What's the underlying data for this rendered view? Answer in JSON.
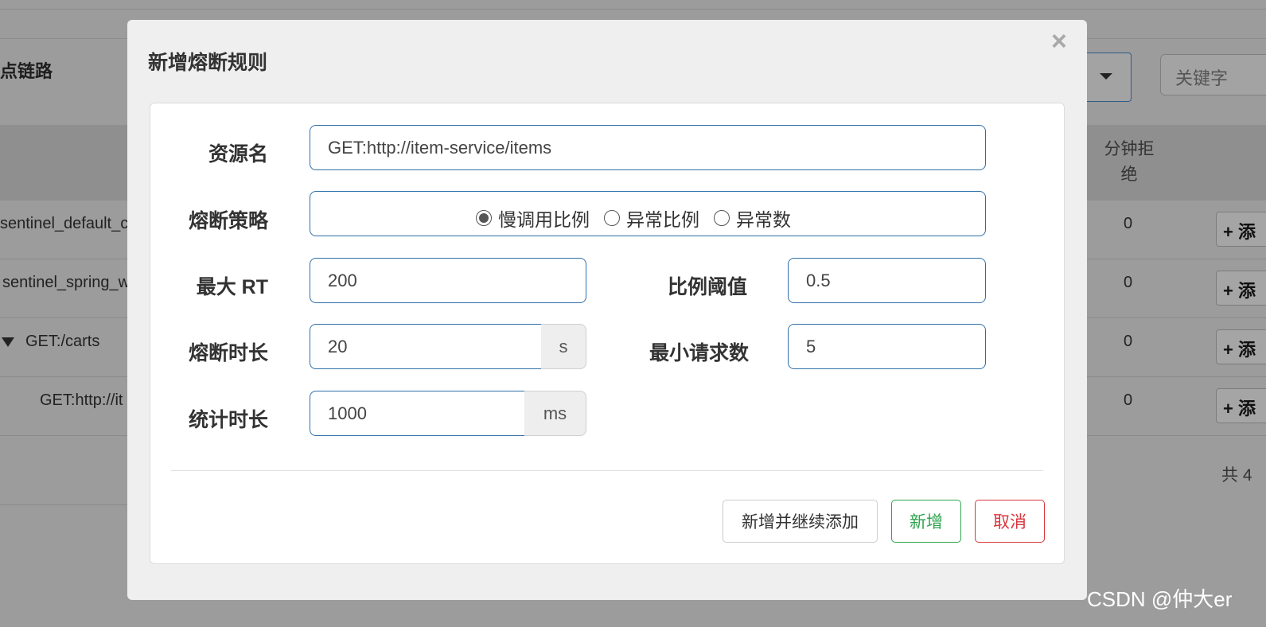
{
  "background": {
    "title": "点链路",
    "search_placeholder": "关键字",
    "column_header": "分钟拒绝",
    "rows": [
      {
        "name": "sentinel_default_c",
        "value": "0"
      },
      {
        "name": "sentinel_spring_w",
        "value": "0"
      },
      {
        "name": "GET:/carts",
        "value": "0"
      },
      {
        "name": "GET:http://it",
        "value": "0"
      }
    ],
    "add_button_label": "+ 添",
    "total": "共 4"
  },
  "modal": {
    "title": "新增熔断规则",
    "close": "×",
    "resource": {
      "label": "资源名",
      "value": "GET:http://item-service/items"
    },
    "strategy": {
      "label": "熔断策略",
      "options": [
        "慢调用比例",
        "异常比例",
        "异常数"
      ],
      "selected": "慢调用比例"
    },
    "max_rt": {
      "label": "最大 RT",
      "value": "200"
    },
    "ratio": {
      "label": "比例阈值",
      "value": "0.5"
    },
    "duration": {
      "label": "熔断时长",
      "value": "20",
      "unit": "s"
    },
    "min_requests": {
      "label": "最小请求数",
      "value": "5"
    },
    "stat_duration": {
      "label": "统计时长",
      "value": "1000",
      "unit": "ms"
    },
    "buttons": {
      "add_continue": "新增并继续添加",
      "add": "新增",
      "cancel": "取消"
    },
    "colors": {
      "primary_border": "#2f6fa8",
      "success": "#2ea44f",
      "danger": "#d9363e"
    }
  },
  "watermark": "CSDN @仲大er"
}
